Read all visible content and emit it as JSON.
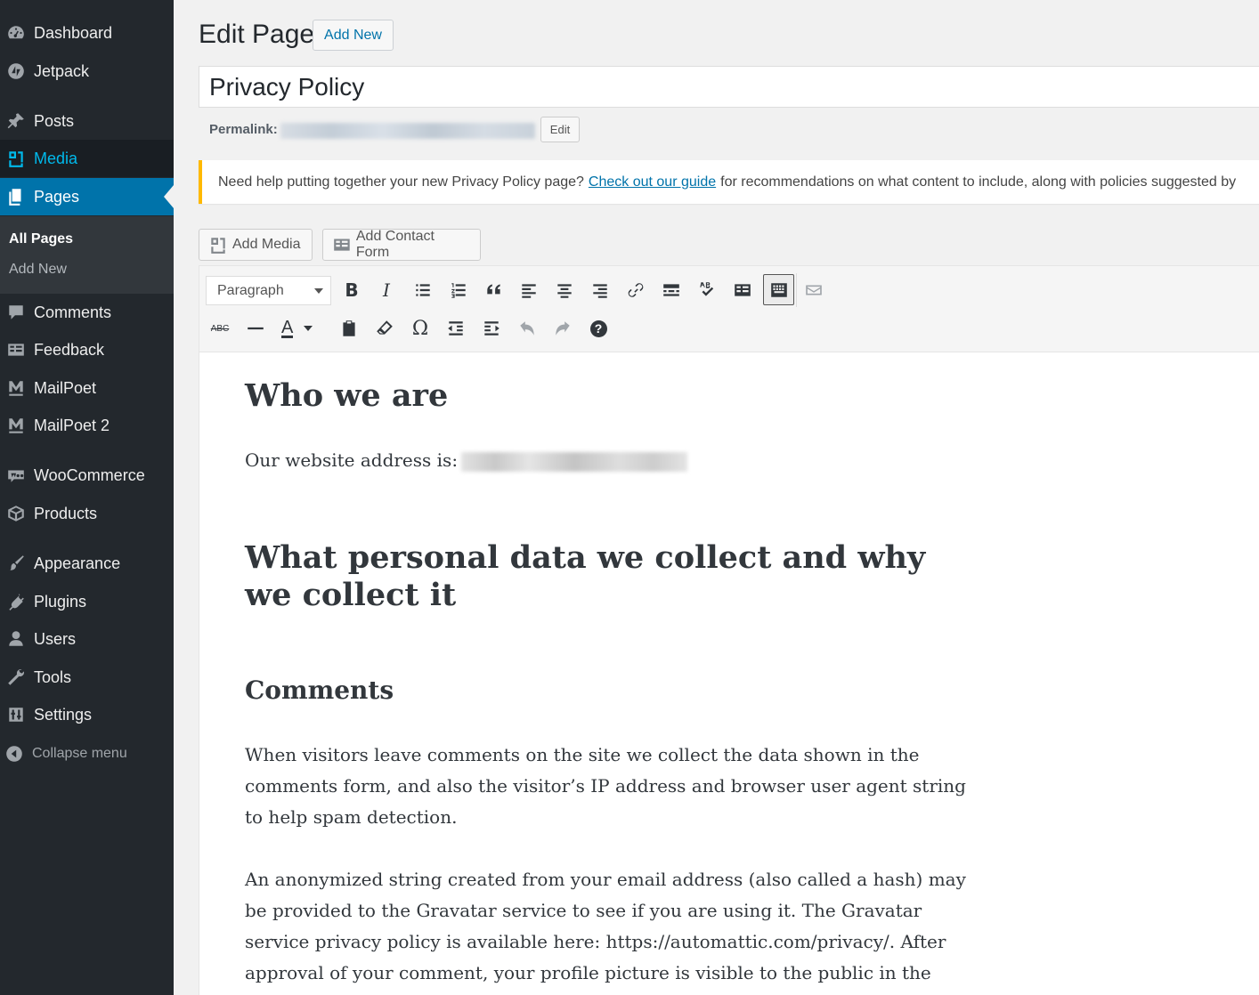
{
  "sidebar": {
    "items": [
      {
        "label": "Dashboard",
        "icon": "dashboard-icon"
      },
      {
        "label": "Jetpack",
        "icon": "jetpack-icon"
      },
      {
        "label": "Posts",
        "icon": "pin-icon"
      },
      {
        "label": "Media",
        "icon": "media-icon",
        "state": "hover"
      },
      {
        "label": "Pages",
        "icon": "pages-icon",
        "state": "current"
      },
      {
        "label": "Comments",
        "icon": "comment-bubble-icon"
      },
      {
        "label": "Feedback",
        "icon": "feedback-icon"
      },
      {
        "label": "MailPoet",
        "icon": "mailpoet-icon"
      },
      {
        "label": "MailPoet 2",
        "icon": "mailpoet-icon"
      },
      {
        "label": "WooCommerce",
        "icon": "woocommerce-icon"
      },
      {
        "label": "Products",
        "icon": "box-icon"
      },
      {
        "label": "Appearance",
        "icon": "paintbrush-icon"
      },
      {
        "label": "Plugins",
        "icon": "plug-icon"
      },
      {
        "label": "Users",
        "icon": "user-icon"
      },
      {
        "label": "Tools",
        "icon": "wrench-icon"
      },
      {
        "label": "Settings",
        "icon": "sliders-icon"
      }
    ],
    "submenu": [
      "All Pages",
      "Add New"
    ],
    "collapse_label": "Collapse menu"
  },
  "header": {
    "title": "Edit Page",
    "add_new_label": "Add New"
  },
  "post": {
    "title": "Privacy Policy",
    "permalink_label": "Permalink:",
    "permalink_edit_label": "Edit"
  },
  "notice": {
    "text_before": "Need help putting together your new Privacy Policy page?",
    "link_text": "Check out our guide",
    "text_after": "for recommendations on what content to include, along with policies suggested by"
  },
  "media_buttons": {
    "add_media": "Add Media",
    "add_contact_form": "Add Contact Form"
  },
  "toolbar": {
    "format_select": "Paragraph",
    "row1_icons": [
      "bold-icon",
      "italic-icon",
      "bulleted-list-icon",
      "numbered-list-icon",
      "blockquote-icon",
      "align-left-icon",
      "align-center-icon",
      "align-right-icon",
      "link-icon",
      "read-more-icon",
      "spellcheck-icon",
      "contact-form-icon",
      "toolbar-toggle-icon",
      "mail-icon"
    ],
    "row2_icons": [
      "strikethrough-icon",
      "horizontal-line-icon",
      "text-color-icon",
      "paste-text-icon",
      "clear-formatting-icon",
      "special-character-icon",
      "outdent-icon",
      "indent-icon",
      "undo-icon",
      "redo-icon",
      "help-icon"
    ],
    "bold_label": "B",
    "italic_label": "I",
    "omega_label": "Ω",
    "textcolor_label": "A",
    "abc_label": "ABC",
    "help_label": "?"
  },
  "content": {
    "heading1": "Who we are",
    "para1": "Our website address is:",
    "heading2": "What personal data we collect and why we collect it",
    "heading3": "Comments",
    "para2": "When visitors leave comments on the site we collect the data shown in the comments form, and also the visitor’s IP address and browser user agent string to help spam detection.",
    "para3": "An anonymized string created from your email address (also called a hash) may be provided to the Gravatar service to see if you are using it. The Gravatar service privacy policy is available here: https://automattic.com/privacy/. After approval of your comment, your profile picture is visible to the public in the"
  },
  "colors": {
    "sidebar_bg": "#23282d",
    "current_bg": "#0073aa",
    "hover_text": "#00b9eb",
    "notice_border": "#ffb900",
    "link": "#0073aa"
  }
}
